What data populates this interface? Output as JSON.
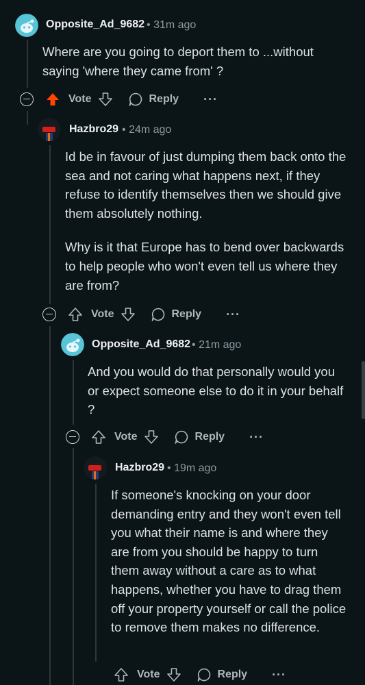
{
  "comments": [
    {
      "author": "Opposite_Ad_9682",
      "time": "31m ago",
      "paragraphs": [
        "Where are you going to deport them to ...without saying 'where they came from' ?"
      ],
      "upvoted": true,
      "vote_label": "Vote",
      "reply_label": "Reply",
      "more": "···"
    },
    {
      "author": "Hazbro29",
      "time": "24m ago",
      "paragraphs": [
        "Id be in favour of just dumping them back onto the sea and not caring what happens next, if they refuse to identify themselves then we should give them absolutely nothing.",
        "Why is it that Europe has to bend over backwards to help people who won't even tell us where they are from?"
      ],
      "upvoted": false,
      "vote_label": "Vote",
      "reply_label": "Reply",
      "more": "···"
    },
    {
      "author": "Opposite_Ad_9682",
      "time": "21m ago",
      "paragraphs": [
        "And you would do that personally would you or expect someone else to do it in your behalf ?"
      ],
      "upvoted": false,
      "vote_label": "Vote",
      "reply_label": "Reply",
      "more": "···"
    },
    {
      "author": "Hazbro29",
      "time": "19m ago",
      "paragraphs": [
        "If someone's knocking on your door demanding entry and they won't even tell you what their name is and where they are from you should be happy to turn them away without a care as to what happens, whether you have to drag them off your property yourself or call the police to remove them makes no difference."
      ],
      "upvoted": false,
      "vote_label": "Vote",
      "reply_label": "Reply",
      "more": "···"
    }
  ],
  "separator": "•",
  "colors": {
    "upvote_active": "#ff4500",
    "background": "#0b1416",
    "snoo_blue": "#58c4d8"
  }
}
